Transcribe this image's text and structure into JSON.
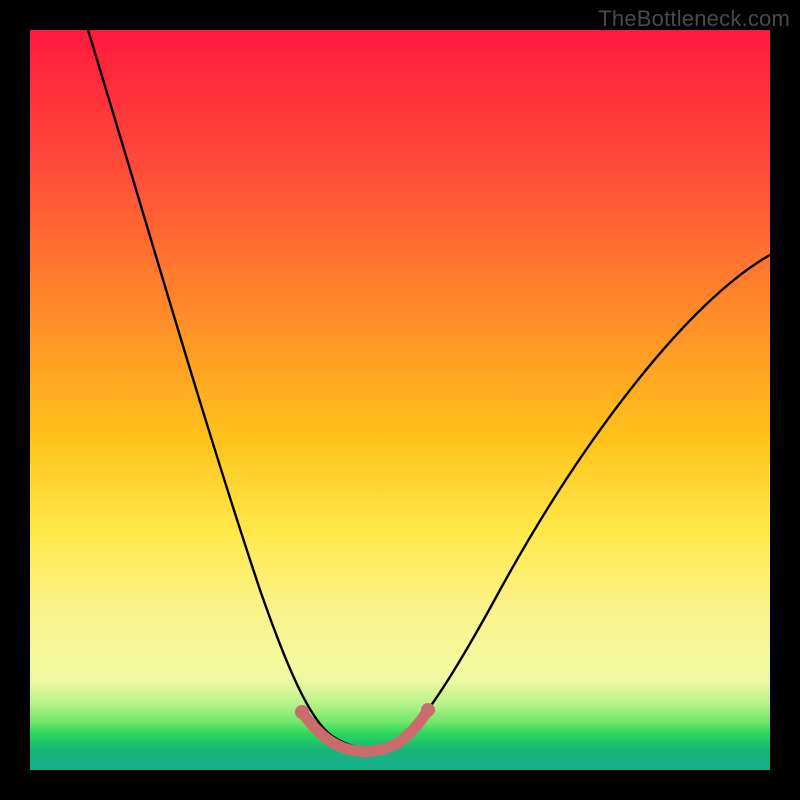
{
  "watermark": "TheBottleneck.com",
  "colors": {
    "page_bg": "#000000",
    "curve": "#000000",
    "highlight": "#cc6b6b",
    "gradient_top": "#ff1a3c",
    "gradient_bottom": "#18b08c"
  },
  "chart_data": {
    "type": "line",
    "title": "",
    "xlabel": "",
    "ylabel": "",
    "xlim": [
      0,
      100
    ],
    "ylim": [
      0,
      100
    ],
    "grid": false,
    "legend": false,
    "annotations": [
      "TheBottleneck.com"
    ],
    "series": [
      {
        "name": "bottleneck-curve",
        "x": [
          0,
          3,
          6,
          9,
          12,
          15,
          18,
          21,
          24,
          27,
          30,
          33,
          36,
          38,
          40,
          42,
          44,
          46,
          48,
          50,
          54,
          60,
          66,
          72,
          78,
          84,
          90,
          96,
          100
        ],
        "y": [
          100,
          93,
          86,
          79,
          72,
          65,
          58,
          51,
          44,
          37,
          30,
          23,
          16,
          11,
          7,
          3,
          1,
          0,
          0,
          1,
          5,
          12,
          20,
          28,
          36,
          44,
          52,
          58,
          62
        ]
      },
      {
        "name": "optimal-region",
        "x": [
          36,
          38,
          40,
          42,
          44,
          46,
          48,
          50
        ],
        "y": [
          16,
          11,
          7,
          3,
          1,
          0,
          0,
          1
        ]
      }
    ]
  }
}
